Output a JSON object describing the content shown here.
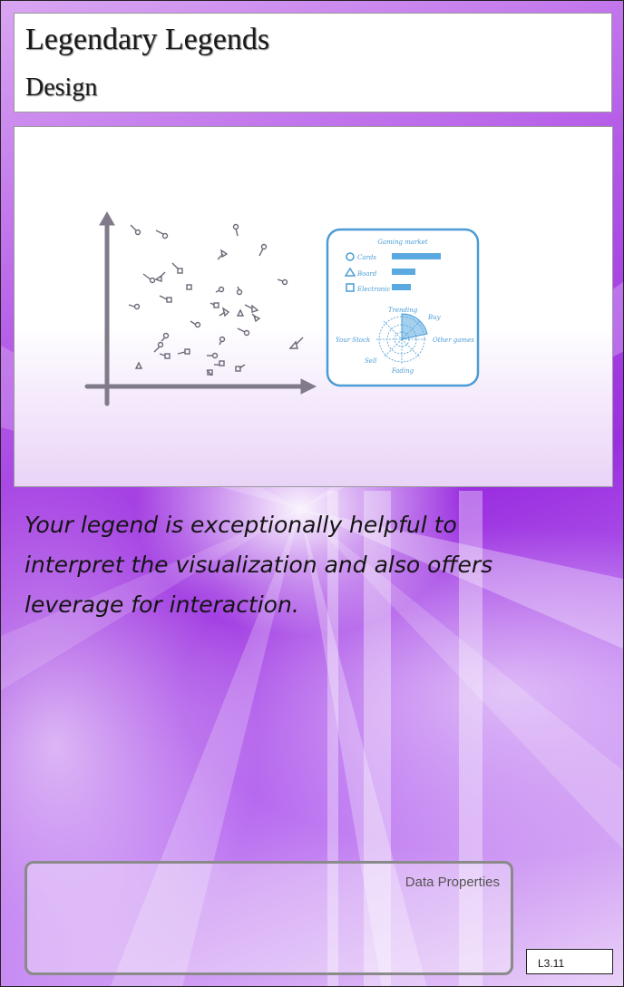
{
  "card": {
    "title": "Legendary Legends",
    "category": "Design",
    "description": "Your legend is exceptionally helpful to interpret the visualization and also offers leverage for interaction.",
    "data_properties_label": "Data Properties",
    "code": "L3.11"
  },
  "illustration": {
    "legend_title": "Gaming market",
    "legend_items": [
      {
        "shape": "circle",
        "label": "Cards",
        "value": 1.0
      },
      {
        "shape": "triangle",
        "label": "Board",
        "value": 0.48
      },
      {
        "shape": "square",
        "label": "Electronic",
        "value": 0.38
      }
    ],
    "radar_labels": {
      "top": "Trending",
      "top_right": "Buy",
      "right": "Other games",
      "bottom": "Fading",
      "bottom_left": "Sell",
      "left": "Your Stock"
    },
    "colors": {
      "legend_accent": "#4a9bd6",
      "bar_fill": "#5aa9e0",
      "plot_axis": "#807a8a",
      "background_purple": "#9b2fe0"
    }
  }
}
